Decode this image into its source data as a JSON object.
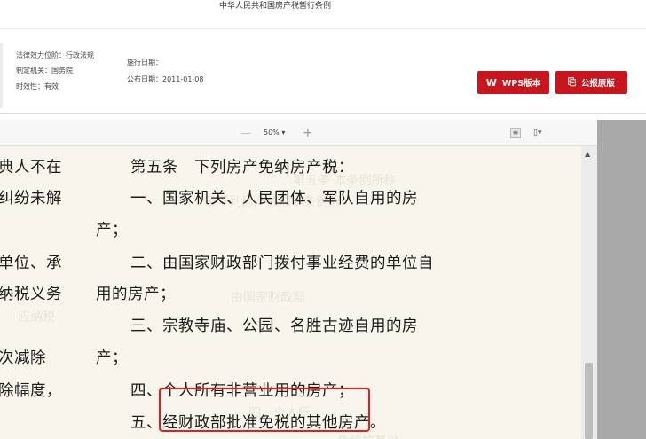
{
  "page_title": "中华人民共和国房产税暂行条例",
  "meta": {
    "effect_level": "法律效力位阶：行政法规",
    "issuer": "制定机关：国务院",
    "validity": "时效性：有效",
    "effective_date": "施行日期：",
    "publish_date": "公布日期：2011-01-08"
  },
  "buttons": {
    "wps": "WPS版本",
    "wps_icon": "wps-logo-icon",
    "original": "公报原版",
    "original_icon": "pdf-icon"
  },
  "toolbar": {
    "zoom_out": "—",
    "zoom": "50% ▾",
    "zoom_in": "+",
    "view_icon": "page-view-icon",
    "bookmark": "▯▾"
  },
  "document": {
    "left_column": [
      "典人不在",
      "纠纷未解",
      "单位、承",
      "纳税义务",
      "次减除",
      "除幅度，"
    ],
    "lines": [
      "第五条　下列房产免纳房产税：",
      "一、国家机关、人民团体、军队自用的房",
      "产；",
      "二、由国家财政部门拨付事业经费的单位自",
      "用的房产；",
      "三、宗教寺庙、公园、名胜古迹自用的房",
      "产；",
      "四、个人所有非营业用的房产；",
      "五、经财政部批准免税的其他房产。"
    ]
  },
  "colors": {
    "accent": "#c8161e",
    "highlight_border": "#e02020",
    "paper": "#f8f6ec",
    "viewer_bg": "#a9a9aa"
  }
}
